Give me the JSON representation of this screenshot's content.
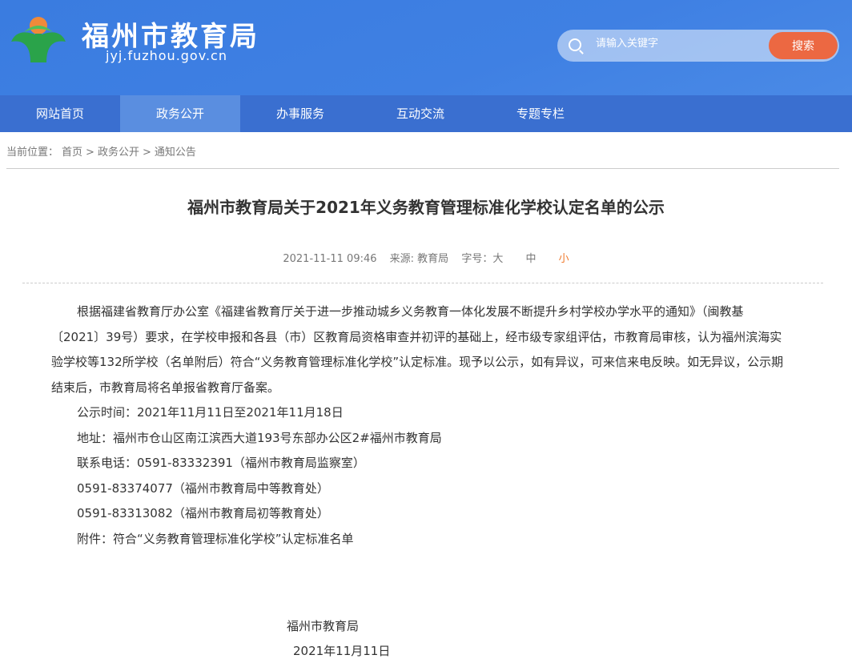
{
  "header": {
    "site_name": "福州市教育局",
    "site_url": "jyj.fuzhou.gov.cn",
    "search_placeholder": "请输入关键字",
    "search_button": "搜索"
  },
  "nav": [
    "网站首页",
    "政务公开",
    "办事服务",
    "互动交流",
    "专题专栏"
  ],
  "breadcrumb": {
    "label": "当前位置：",
    "items": [
      "首页",
      "政务公开",
      "通知公告"
    ],
    "sep": ">"
  },
  "article": {
    "title": "福州市教育局关于2021年义务教育管理标准化学校认定名单的公示",
    "date": "2021-11-11 09:46",
    "source": "来源: 教育局",
    "font_size_label": "字号：大",
    "font_mid": "中",
    "font_small": "小",
    "paragraphs": [
      "根据福建省教育厅办公室《福建省教育厅关于进一步推动城乡义务教育一体化发展不断提升乡村学校办学水平的通知》（闽教基〔2021〕39号）要求，在学校申报和各县（市）区教育局资格审查并初评的基础上，经市级专家组评估，市教育局审核，认为福州滨海实验学校等132所学校（名单附后）符合“义务教育管理标准化学校”认定标准。现予以公示，如有异议，可来信来电反映。如无异议，公示期结束后，市教育局将名单报省教育厅备案。",
      "公示时间：2021年11月11日至2021年11月18日",
      "地址：福州市仓山区南江滨西大道193号东部办公区2#福州市教育局",
      "联系电话：0591-83332391（福州市教育局监察室）",
      "0591-83374077（福州市教育局中等教育处）",
      "0591-83313082（福州市教育局初等教育处）",
      "附件：符合“义务教育管理标准化学校”认定标准名单"
    ],
    "signature": "福州市教育局",
    "sign_date": "2021年11月11日"
  }
}
